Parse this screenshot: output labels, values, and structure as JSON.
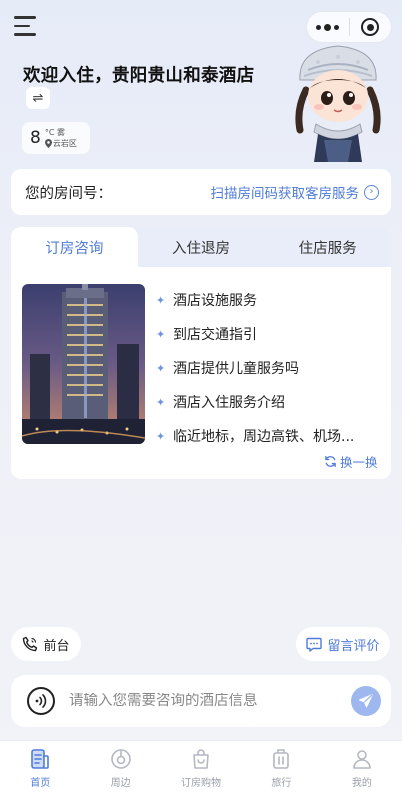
{
  "header": {
    "welcome": "欢迎入住，贵阳贵山和泰酒店",
    "swap_icon": "swap-icon",
    "weather": {
      "temp": "8",
      "unit_condition": "°C 雾",
      "location": "云岩区"
    }
  },
  "capsule": {
    "more_icon": "more-dots-icon",
    "close_icon": "target-icon"
  },
  "room": {
    "label": "您的房间号：",
    "scan_link": "扫描房间码获取客房服务"
  },
  "tabs": [
    {
      "label": "订房咨询",
      "active": true
    },
    {
      "label": "入住退房",
      "active": false
    },
    {
      "label": "住店服务",
      "active": false
    }
  ],
  "questions": [
    "酒店设施服务",
    "到店交通指引",
    "酒店提供儿童服务吗",
    "酒店入住服务介绍",
    "临近地标，周边高铁、机场..."
  ],
  "refresh_label": "换一换",
  "actions": {
    "front_desk": "前台",
    "review": "留言评价"
  },
  "input": {
    "placeholder": "请输入您需要咨询的酒店信息"
  },
  "nav": [
    {
      "label": "首页",
      "icon": "home-icon",
      "active": true
    },
    {
      "label": "周边",
      "icon": "nearby-icon",
      "active": false
    },
    {
      "label": "订房购物",
      "icon": "shopping-bag-icon",
      "active": false
    },
    {
      "label": "旅行",
      "icon": "luggage-icon",
      "active": false
    },
    {
      "label": "我的",
      "icon": "profile-icon",
      "active": false
    }
  ],
  "colors": {
    "accent": "#4f7cd8",
    "send": "#9fb7ef",
    "tab_bg": "#e9edf9"
  }
}
